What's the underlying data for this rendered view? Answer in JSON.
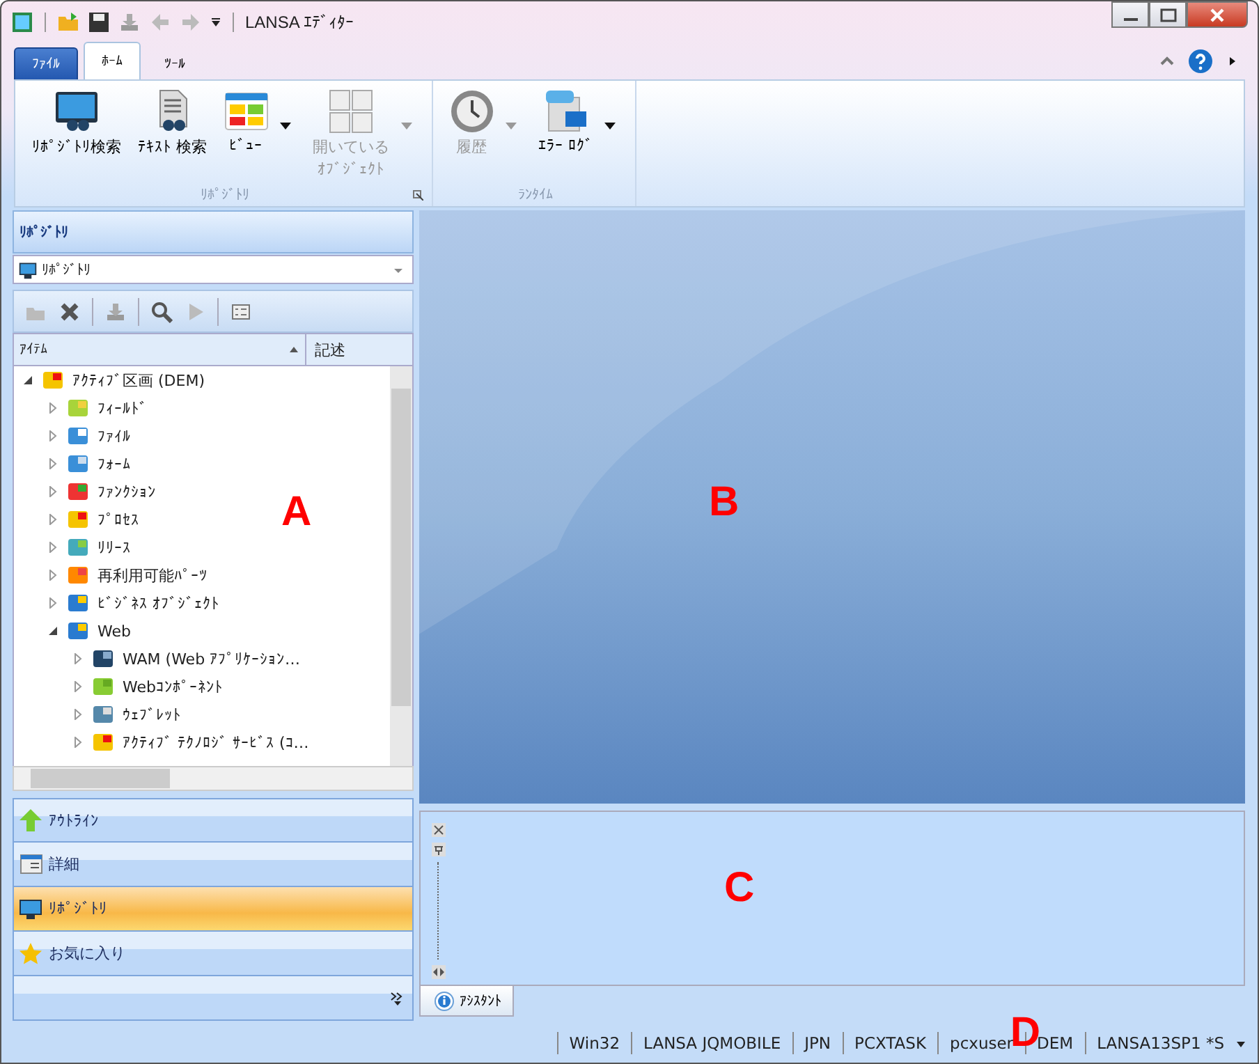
{
  "window": {
    "title": "LANSA ｴﾃﾞｨﾀｰ"
  },
  "ribbon_tabs": [
    {
      "label": "ﾌｧｲﾙ",
      "kind": "file",
      "selected": false
    },
    {
      "label": "ﾎｰﾑ",
      "kind": "tab",
      "selected": true
    },
    {
      "label": "ﾂｰﾙ",
      "kind": "tab",
      "selected": false
    }
  ],
  "ribbon_groups": [
    {
      "label": "ﾘﾎﾟｼﾞﾄﾘ",
      "launcher": true,
      "buttons": [
        {
          "label": "ﾘﾎﾟｼﾞﾄﾘ検索",
          "disabled": false,
          "dropdown": false
        },
        {
          "label": "ﾃｷｽﾄ 検索",
          "disabled": false,
          "dropdown": false
        },
        {
          "label": "ﾋﾞｭｰ",
          "disabled": false,
          "dropdown": true
        },
        {
          "label": "開いている",
          "label2": "ｵﾌﾞｼﾞｪｸﾄ",
          "disabled": true,
          "dropdown": true
        }
      ]
    },
    {
      "label": "ﾗﾝﾀｲﾑ",
      "buttons": [
        {
          "label": "履歴",
          "disabled": true,
          "dropdown": true
        },
        {
          "label": "ｴﾗｰ ﾛｸﾞ",
          "disabled": false,
          "dropdown": true
        }
      ]
    }
  ],
  "left_panel": {
    "title": "ﾘﾎﾟｼﾞﾄﾘ",
    "selector": "ﾘﾎﾟｼﾞﾄﾘ",
    "columns": [
      "ｱｲﾃﾑ",
      "記述"
    ],
    "tree": [
      {
        "label": "ｱｸﾃｨﾌﾞ区画 (DEM)",
        "expanded": true,
        "children": [
          {
            "label": "ﾌｨｰﾙﾄﾞ",
            "expanded": false
          },
          {
            "label": "ﾌｧｲﾙ",
            "expanded": false
          },
          {
            "label": "ﾌｫｰﾑ",
            "expanded": false
          },
          {
            "label": "ﾌｧﾝｸｼｮﾝ",
            "expanded": false
          },
          {
            "label": "ﾌﾟﾛｾｽ",
            "expanded": false
          },
          {
            "label": "ﾘﾘｰｽ",
            "expanded": false
          },
          {
            "label": "再利用可能ﾊﾟｰﾂ",
            "expanded": false
          },
          {
            "label": "ﾋﾞｼﾞﾈｽ ｵﾌﾞｼﾞｪｸﾄ",
            "expanded": false
          },
          {
            "label": "Web",
            "expanded": true,
            "children": [
              {
                "label": "WAM (Web ｱﾌﾟﾘｹｰｼｮﾝ…",
                "expanded": false
              },
              {
                "label": "Webｺﾝﾎﾟｰﾈﾝﾄ",
                "expanded": false
              },
              {
                "label": "ｳｪﾌﾞﾚｯﾄ",
                "expanded": false
              },
              {
                "label": "ｱｸﾃｨﾌﾞ ﾃｸﾉﾛｼﾞ ｻｰﾋﾞｽ (ｺ…",
                "expanded": false
              }
            ]
          }
        ]
      }
    ],
    "marker": "A",
    "nav": [
      {
        "label": "ｱｳﾄﾗｲﾝ",
        "selected": false
      },
      {
        "label": "詳細",
        "selected": false
      },
      {
        "label": "ﾘﾎﾟｼﾞﾄﾘ",
        "selected": true
      },
      {
        "label": "お気に入り",
        "selected": false
      }
    ]
  },
  "workspace": {
    "marker": "B"
  },
  "assistant": {
    "marker": "C",
    "tab": "ｱｼｽﾀﾝﾄ"
  },
  "status_bar": {
    "items": [
      "Win32",
      "LANSA JQMOBILE",
      "JPN",
      "PCXTASK",
      "pcxuser",
      "DEM",
      "LANSA13SP1 *S"
    ],
    "marker": "D"
  }
}
